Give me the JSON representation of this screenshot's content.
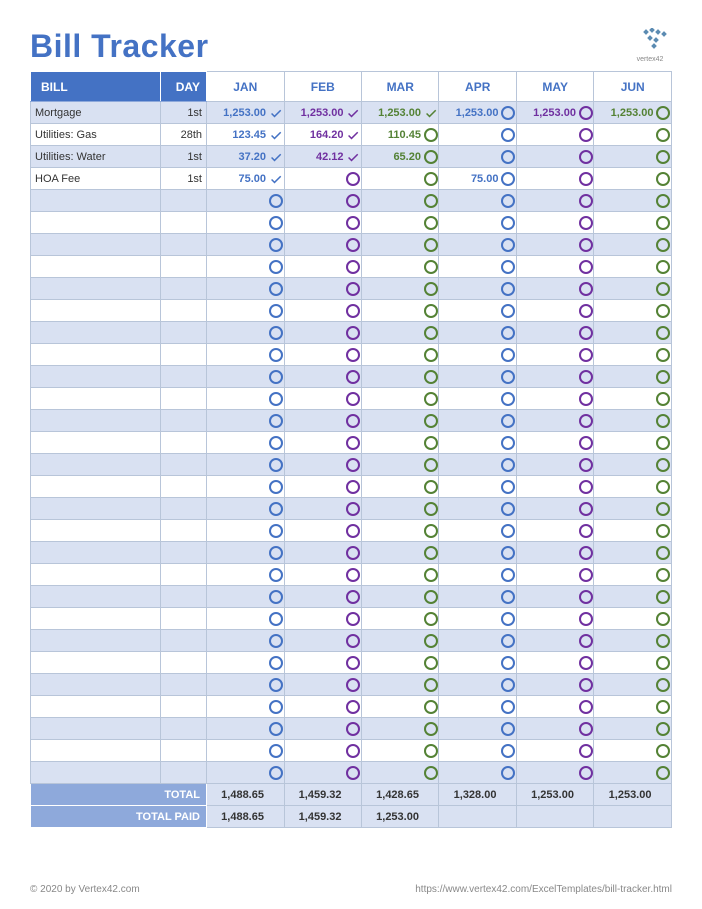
{
  "title": "Bill Tracker",
  "brand": "vertex42",
  "colors": {
    "jan": "#4472c4",
    "feb": "#7030a0",
    "mar": "#548235",
    "apr": "#4472c4",
    "may": "#7030a0",
    "jun": "#548235",
    "header_bg": "#4472c4",
    "band_even": "#d9e1f2"
  },
  "headers": {
    "bill": "BILL",
    "day": "DAY",
    "months": [
      "JAN",
      "FEB",
      "MAR",
      "APR",
      "MAY",
      "JUN"
    ]
  },
  "month_color_class": [
    "m-jan",
    "m-feb",
    "m-mar",
    "m-apr",
    "m-may",
    "m-jun"
  ],
  "cell_color_class": [
    "c-jan",
    "c-feb",
    "c-mar",
    "c-apr",
    "c-may",
    "c-jun"
  ],
  "rows": [
    {
      "bill": "Mortgage",
      "day": "1st",
      "cells": [
        {
          "val": "1,253.00",
          "paid": true
        },
        {
          "val": "1,253.00",
          "paid": true
        },
        {
          "val": "1,253.00",
          "paid": true
        },
        {
          "val": "1,253.00",
          "paid": false
        },
        {
          "val": "1,253.00",
          "paid": false
        },
        {
          "val": "1,253.00",
          "paid": false
        }
      ]
    },
    {
      "bill": "Utilities: Gas",
      "day": "28th",
      "cells": [
        {
          "val": "123.45",
          "paid": true
        },
        {
          "val": "164.20",
          "paid": true
        },
        {
          "val": "110.45",
          "paid": false
        },
        {
          "val": "",
          "paid": false
        },
        {
          "val": "",
          "paid": false
        },
        {
          "val": "",
          "paid": false
        }
      ]
    },
    {
      "bill": "Utilities: Water",
      "day": "1st",
      "cells": [
        {
          "val": "37.20",
          "paid": true
        },
        {
          "val": "42.12",
          "paid": true
        },
        {
          "val": "65.20",
          "paid": false
        },
        {
          "val": "",
          "paid": false
        },
        {
          "val": "",
          "paid": false
        },
        {
          "val": "",
          "paid": false
        }
      ]
    },
    {
      "bill": "HOA Fee",
      "day": "1st",
      "cells": [
        {
          "val": "75.00",
          "paid": true
        },
        {
          "val": "",
          "paid": false
        },
        {
          "val": "",
          "paid": false
        },
        {
          "val": "75.00",
          "paid": false
        },
        {
          "val": "",
          "paid": false
        },
        {
          "val": "",
          "paid": false
        }
      ]
    }
  ],
  "empty_row_count": 27,
  "totals": {
    "label_total": "TOTAL",
    "label_paid": "TOTAL PAID",
    "total": [
      "1,488.65",
      "1,459.32",
      "1,428.65",
      "1,328.00",
      "1,253.00",
      "1,253.00"
    ],
    "total_paid": [
      "1,488.65",
      "1,459.32",
      "1,253.00",
      "",
      "",
      ""
    ]
  },
  "footer": {
    "left": "© 2020 by Vertex42.com",
    "right": "https://www.vertex42.com/ExcelTemplates/bill-tracker.html"
  }
}
